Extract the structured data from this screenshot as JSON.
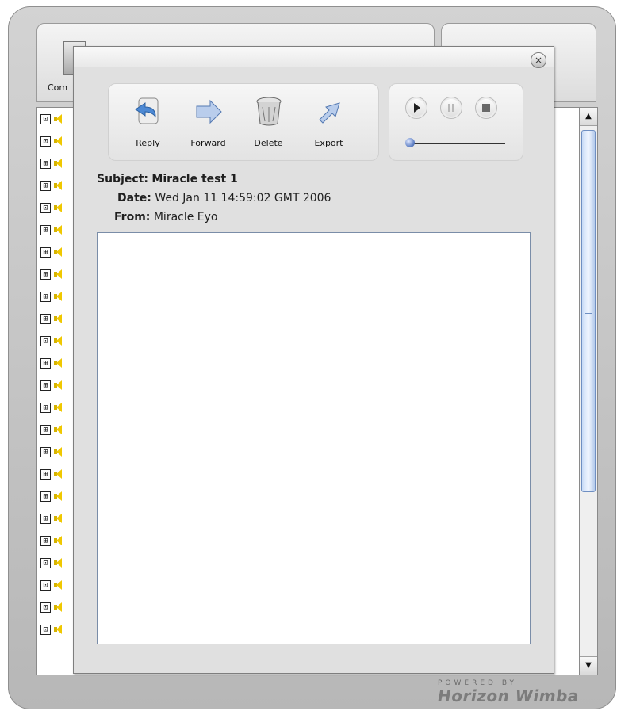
{
  "background": {
    "compose_label": "Com",
    "list_expanders": [
      "⊡",
      "⊡",
      "⊞",
      "⊞",
      "⊡",
      "⊞",
      "⊞",
      "⊞",
      "⊞",
      "⊞",
      "⊡",
      "⊞",
      "⊞",
      "⊞",
      "⊞",
      "⊞",
      "⊞",
      "⊞",
      "⊞",
      "⊞",
      "⊡",
      "⊡",
      "⊡",
      "⊡"
    ],
    "powered_by": "POWERED BY",
    "brand": "Horizon Wimba"
  },
  "dialog": {
    "toolbar": {
      "reply_label": "Reply",
      "forward_label": "Forward",
      "delete_label": "Delete",
      "export_label": "Export"
    },
    "media": {
      "position": 0
    },
    "message": {
      "subject_key": "Subject:",
      "subject_value": "Miracle test 1",
      "date_key": "Date:",
      "date_value": "Wed Jan 11 14:59:02 GMT 2006",
      "from_key": "From:",
      "from_value": "Miracle Eyo"
    }
  },
  "colors": {
    "accent": "#5e7fc4",
    "frame": "#b7b7b7"
  }
}
